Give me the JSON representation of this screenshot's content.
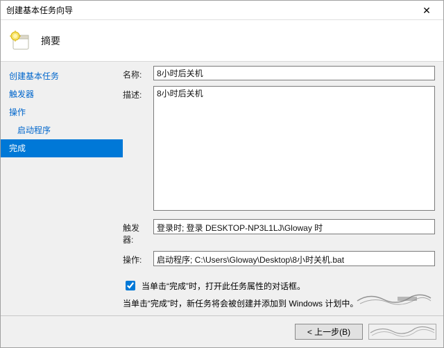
{
  "titlebar": {
    "title": "创建基本任务向导"
  },
  "header": {
    "heading": "摘要",
    "icon": "calendar-sun-icon"
  },
  "sidebar": {
    "items": [
      {
        "label": "创建基本任务",
        "indent": 0,
        "active": false
      },
      {
        "label": "触发器",
        "indent": 0,
        "active": false
      },
      {
        "label": "操作",
        "indent": 0,
        "active": false
      },
      {
        "label": "启动程序",
        "indent": 1,
        "active": false
      },
      {
        "label": "完成",
        "indent": 0,
        "active": true
      }
    ]
  },
  "form": {
    "name_label": "名称:",
    "name_value": "8小时后关机",
    "desc_label": "描述:",
    "desc_value": "8小时后关机",
    "trigger_label": "触发器:",
    "trigger_value": "登录时; 登录 DESKTOP-NP3L1LJ\\Gloway 时",
    "action_label": "操作:",
    "action_value": "启动程序; C:\\Users\\Gloway\\Desktop\\8小时关机.bat"
  },
  "options": {
    "open_props_checked": true,
    "open_props_label": "当单击“完成”时，打开此任务属性的对话框。",
    "footer_note": "当单击“完成”时，新任务将会被创建并添加到 Windows 计划中。"
  },
  "footer": {
    "back_label": "< 上一步(B)"
  }
}
